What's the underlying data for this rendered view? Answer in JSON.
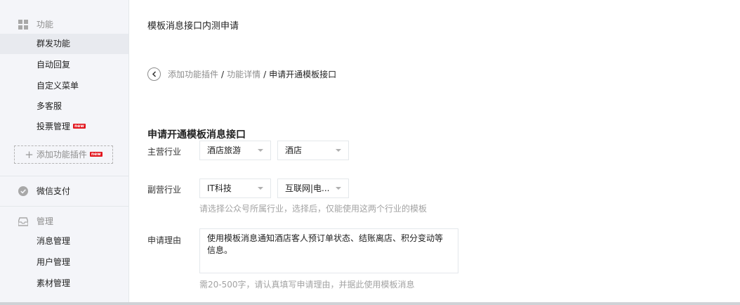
{
  "sidebar": {
    "functions_header": "功能",
    "items": [
      "群发功能",
      "自动回复",
      "自定义菜单",
      "多客服"
    ],
    "vote_label": "投票管理",
    "new_badge": "new",
    "add_plugin_label": "添加功能插件",
    "wechat_pay_label": "微信支付",
    "manage_header": "管理",
    "manage_items": [
      "消息管理",
      "用户管理",
      "素材管理"
    ],
    "active_item": "群发功能"
  },
  "main": {
    "page_title": "模板消息接口内测申请",
    "breadcrumb": {
      "link1": "添加功能插件",
      "sep": "/",
      "link2": "功能详情",
      "current": "申请开通模板接口"
    },
    "form_title": "申请开通模板消息接口",
    "primary_industry": {
      "label": "主营行业",
      "select1": "酒店旅游",
      "select2": "酒店"
    },
    "secondary_industry": {
      "label": "副营行业",
      "select1": "IT科技",
      "select2": "互联网|电...",
      "hint": "请选择公众号所属行业，选择后，仅能使用这两个行业的模板"
    },
    "reason": {
      "label": "申请理由",
      "value": "使用模板消息通知酒店客人预订单状态、结账离店、积分变动等信息。",
      "hint": "需20-500字，请认真填写申请理由，并据此使用模板消息"
    }
  },
  "colors": {
    "sidebar_bg": "#f4f5f9",
    "active_bg": "#e8eaef",
    "badge_red": "#e2161e",
    "hint_gray": "#a3a3a3"
  }
}
